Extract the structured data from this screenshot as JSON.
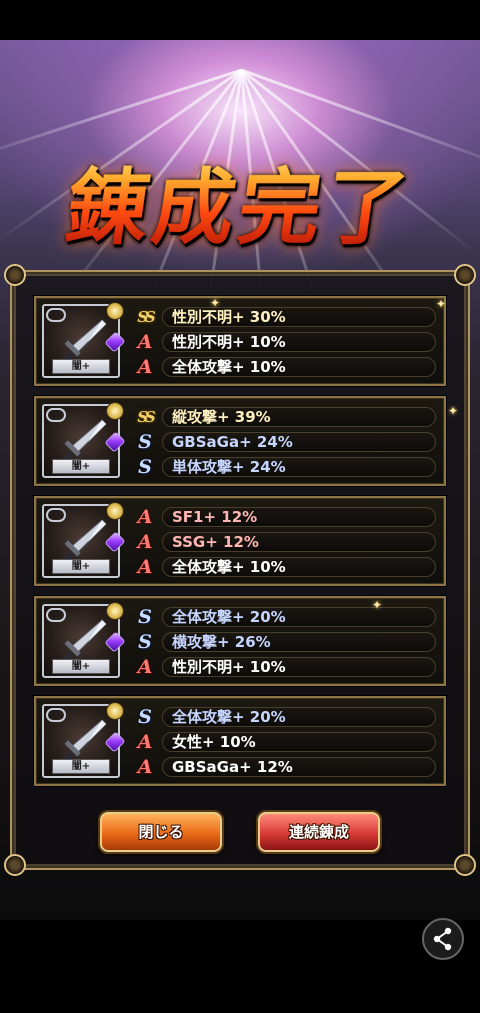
{
  "title": "錬成完了",
  "results": [
    {
      "item_label": "闇+",
      "traits": [
        {
          "rank": "SS",
          "text": "性別不明+ 30%",
          "tone": "gold"
        },
        {
          "rank": "A",
          "text": "性別不明+ 10%",
          "tone": "white"
        },
        {
          "rank": "A",
          "text": "全体攻撃+ 10%",
          "tone": "white"
        }
      ]
    },
    {
      "item_label": "闇+",
      "traits": [
        {
          "rank": "SS",
          "text": "縦攻撃+ 39%",
          "tone": "gold"
        },
        {
          "rank": "S",
          "text": "GBSaGa+ 24%",
          "tone": "blue"
        },
        {
          "rank": "S",
          "text": "単体攻撃+ 24%",
          "tone": "blue"
        }
      ]
    },
    {
      "item_label": "闇+",
      "traits": [
        {
          "rank": "A",
          "text": "SF1+ 12%",
          "tone": "red"
        },
        {
          "rank": "A",
          "text": "SSG+ 12%",
          "tone": "red"
        },
        {
          "rank": "A",
          "text": "全体攻撃+ 10%",
          "tone": "white"
        }
      ]
    },
    {
      "item_label": "闇+",
      "traits": [
        {
          "rank": "S",
          "text": "全体攻撃+ 20%",
          "tone": "blue"
        },
        {
          "rank": "S",
          "text": "横攻撃+ 26%",
          "tone": "blue"
        },
        {
          "rank": "A",
          "text": "性別不明+ 10%",
          "tone": "white"
        }
      ]
    },
    {
      "item_label": "闇+",
      "traits": [
        {
          "rank": "S",
          "text": "全体攻撃+ 20%",
          "tone": "blue"
        },
        {
          "rank": "A",
          "text": "女性+ 10%",
          "tone": "white"
        },
        {
          "rank": "A",
          "text": "GBSaGa+ 12%",
          "tone": "white"
        }
      ]
    }
  ],
  "rank_glyphs": {
    "SS": "SS",
    "S": "S",
    "A": "A"
  },
  "buttons": {
    "close_label": "閉じる",
    "continue_label": "連続錬成"
  },
  "icons": {
    "share": "share-icon",
    "sword": "sword-icon",
    "gem": "gem-icon"
  },
  "colors": {
    "title_fire": "#ff4a10",
    "close_button": "#ea6a18",
    "continue_button": "#d83a36",
    "frame_gold": "#b09460"
  }
}
